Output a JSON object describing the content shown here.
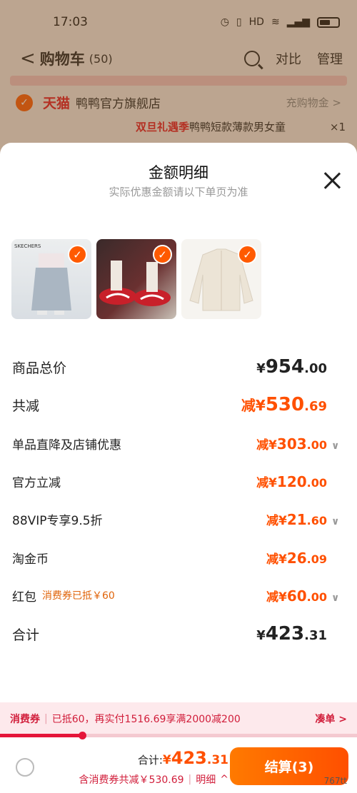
{
  "status_bar": {
    "time": "17:03",
    "icons_text": "HD"
  },
  "cart_header": {
    "back": "<",
    "title": "购物车",
    "count": "(50)",
    "compare": "对比",
    "manage": "管理"
  },
  "store": {
    "brand": "天猫",
    "name": "鸭鸭官方旗舰店",
    "coupon_link": "充购物金 >"
  },
  "cart_item": {
    "tag": "双旦礼遇季",
    "title": "鸭鸭短款薄款男女童",
    "qty": "×1"
  },
  "sheet": {
    "title": "金额明细",
    "subtitle": "实际优惠金额请以下单页为准"
  },
  "rows": [
    {
      "label": "商品总价",
      "prefix": "¥",
      "integer": "954",
      "decimal": ".00",
      "style": "black-big",
      "chevron": false
    },
    {
      "label": "共减",
      "prefix": "减¥",
      "integer": "530",
      "decimal": ".69",
      "style": "orange-big",
      "chevron": false
    },
    {
      "label": "单品直降及店铺优惠",
      "prefix": "减¥",
      "integer": "303",
      "decimal": ".00",
      "style": "orange-mid",
      "chevron": true
    },
    {
      "label": "官方立减",
      "prefix": "减¥",
      "integer": "120",
      "decimal": ".00",
      "style": "orange-mid",
      "chevron": false
    },
    {
      "label": "88VIP专享9.5折",
      "prefix": "减¥",
      "integer": "21",
      "decimal": ".60",
      "style": "orange-mid",
      "chevron": true
    },
    {
      "label": "淘金币",
      "prefix": "减¥",
      "integer": "26",
      "decimal": ".09",
      "style": "orange-mid",
      "chevron": false
    },
    {
      "label": "红包",
      "note": "消费券已抵￥60",
      "prefix": "减¥",
      "integer": "60",
      "decimal": ".00",
      "style": "orange-mid",
      "chevron": true
    },
    {
      "label": "合计",
      "prefix": "¥",
      "integer": "423",
      "decimal": ".31",
      "style": "black-big",
      "chevron": false
    }
  ],
  "coupon_bar": {
    "tag": "消费券",
    "text": "已抵60，再实付1516.69享满2000减200",
    "action": "凑单 >",
    "progress": 0.23
  },
  "checkout": {
    "total_label": "合计:",
    "total_yen": "¥",
    "total_integer": "423",
    "total_decimal": ".31",
    "saving_text": "含消费券共减￥530.69",
    "detail_text": "明细",
    "detail_arrow": "^",
    "button_label": "结算(3)",
    "watermark": "767tt"
  },
  "colors": {
    "accent": "#ff5000",
    "coupon_red": "#d11d3a",
    "check": "#ff5a00"
  }
}
